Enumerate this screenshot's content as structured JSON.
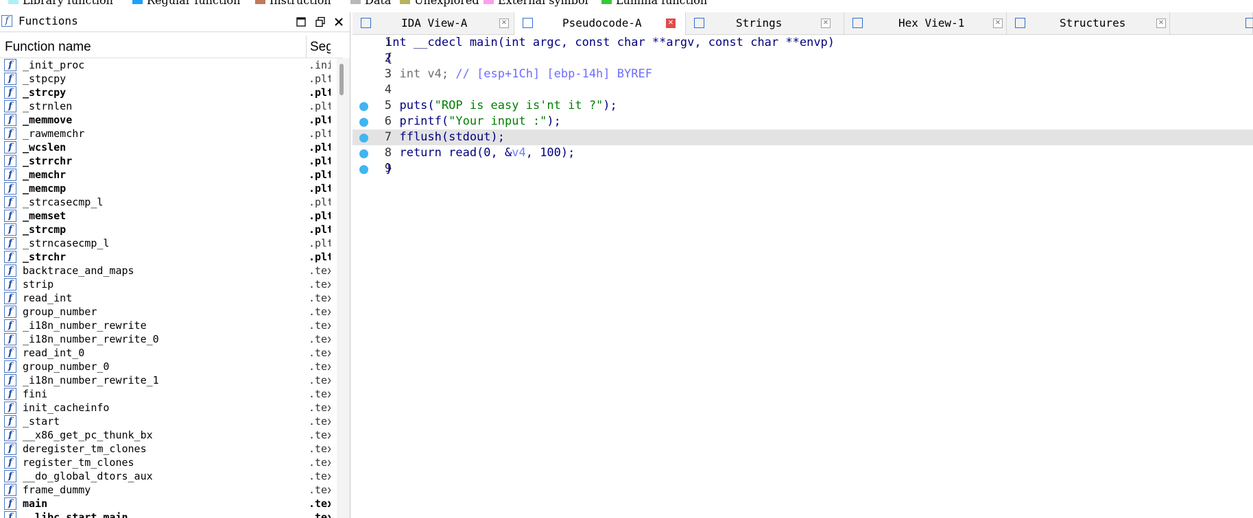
{
  "legend": [
    {
      "label": "Library function",
      "color": "#aaf2f7"
    },
    {
      "label": "Regular function",
      "color": "#1e9fff"
    },
    {
      "label": "Instruction",
      "color": "#c07a5e"
    },
    {
      "label": "Data",
      "color": "#b8b8b8"
    },
    {
      "label": "Unexplored",
      "color": "#b5b35c"
    },
    {
      "label": "External symbol",
      "color": "#ff9eea"
    },
    {
      "label": "Lumina function",
      "color": "#38c838"
    }
  ],
  "functions_panel": {
    "title": "Functions",
    "col_name": "Function name",
    "col_segment": "Segment",
    "rows": [
      {
        "name": "_init_proc",
        "seg": ".init",
        "bold": false
      },
      {
        "name": "_stpcpy",
        "seg": ".plt",
        "bold": false
      },
      {
        "name": "_strcpy",
        "seg": ".plt",
        "bold": true
      },
      {
        "name": "_strnlen",
        "seg": ".plt",
        "bold": false
      },
      {
        "name": "_memmove",
        "seg": ".plt",
        "bold": true
      },
      {
        "name": "_rawmemchr",
        "seg": ".plt",
        "bold": false
      },
      {
        "name": "_wcslen",
        "seg": ".plt",
        "bold": true
      },
      {
        "name": "_strrchr",
        "seg": ".plt",
        "bold": true
      },
      {
        "name": "_memchr",
        "seg": ".plt",
        "bold": true
      },
      {
        "name": "_memcmp",
        "seg": ".plt",
        "bold": true
      },
      {
        "name": "_strcasecmp_l",
        "seg": ".plt",
        "bold": false
      },
      {
        "name": "_memset",
        "seg": ".plt",
        "bold": true
      },
      {
        "name": "_strcmp",
        "seg": ".plt",
        "bold": true
      },
      {
        "name": "_strncasecmp_l",
        "seg": ".plt",
        "bold": false
      },
      {
        "name": "_strchr",
        "seg": ".plt",
        "bold": true
      },
      {
        "name": "backtrace_and_maps",
        "seg": ".text",
        "bold": false
      },
      {
        "name": "strip",
        "seg": ".text",
        "bold": false
      },
      {
        "name": "read_int",
        "seg": ".text",
        "bold": false
      },
      {
        "name": "group_number",
        "seg": ".text",
        "bold": false
      },
      {
        "name": "_i18n_number_rewrite",
        "seg": ".text",
        "bold": false
      },
      {
        "name": "_i18n_number_rewrite_0",
        "seg": ".text",
        "bold": false
      },
      {
        "name": "read_int_0",
        "seg": ".text",
        "bold": false
      },
      {
        "name": "group_number_0",
        "seg": ".text",
        "bold": false
      },
      {
        "name": "_i18n_number_rewrite_1",
        "seg": ".text",
        "bold": false
      },
      {
        "name": "fini",
        "seg": ".text",
        "bold": false
      },
      {
        "name": "init_cacheinfo",
        "seg": ".text",
        "bold": false
      },
      {
        "name": "_start",
        "seg": ".text",
        "bold": false
      },
      {
        "name": "__x86_get_pc_thunk_bx",
        "seg": ".text",
        "bold": false
      },
      {
        "name": "deregister_tm_clones",
        "seg": ".text",
        "bold": false
      },
      {
        "name": "register_tm_clones",
        "seg": ".text",
        "bold": false
      },
      {
        "name": "__do_global_dtors_aux",
        "seg": ".text",
        "bold": false
      },
      {
        "name": "frame_dummy",
        "seg": ".text",
        "bold": false
      },
      {
        "name": "main",
        "seg": ".text",
        "bold": true
      },
      {
        "name": "__libc_start_main",
        "seg": ".text",
        "bold": true
      }
    ]
  },
  "tabs": [
    {
      "label": "IDA View-A",
      "icon": "ida-view-icon",
      "active": false
    },
    {
      "label": "Pseudocode-A",
      "icon": "pseudocode-icon",
      "active": true
    },
    {
      "label": "Strings",
      "icon": "strings-icon",
      "active": false
    },
    {
      "label": "Hex View-1",
      "icon": "hex-view-icon",
      "active": false
    },
    {
      "label": "Structures",
      "icon": "structures-icon",
      "active": false
    }
  ],
  "code": {
    "lines": [
      {
        "num": "1",
        "dot": false,
        "segments": [
          {
            "t": "int __cdecl main(int argc, const char **argv, const char **envp)",
            "c": "kw"
          }
        ]
      },
      {
        "num": "2",
        "dot": false,
        "segments": [
          {
            "t": "{",
            "c": "kw"
          }
        ]
      },
      {
        "num": "3",
        "dot": false,
        "segments": [
          {
            "t": "  int v4; ",
            "c": "var-gray"
          },
          {
            "t": "// [esp+1Ch] [ebp-14h] BYREF",
            "c": "cm"
          }
        ]
      },
      {
        "num": "4",
        "dot": false,
        "segments": []
      },
      {
        "num": "5",
        "dot": true,
        "segments": [
          {
            "t": "  puts(",
            "c": "kw"
          },
          {
            "t": "\"ROP is easy is'nt it ?\"",
            "c": "str"
          },
          {
            "t": ");",
            "c": "kw"
          }
        ]
      },
      {
        "num": "6",
        "dot": true,
        "segments": [
          {
            "t": "  printf(",
            "c": "kw"
          },
          {
            "t": "\"Your input :\"",
            "c": "str"
          },
          {
            "t": ");",
            "c": "kw"
          }
        ]
      },
      {
        "num": "7",
        "dot": true,
        "highlight": true,
        "segments": [
          {
            "t": "  fflush(stdout);",
            "c": "kw"
          }
        ]
      },
      {
        "num": "8",
        "dot": true,
        "segments": [
          {
            "t": "  return read(0, &",
            "c": "kw"
          },
          {
            "t": "v4",
            "c": "var-blue"
          },
          {
            "t": ", 100);",
            "c": "kw"
          }
        ]
      },
      {
        "num": "9",
        "dot": true,
        "segments": [
          {
            "t": "}",
            "c": "kw"
          }
        ]
      }
    ]
  }
}
